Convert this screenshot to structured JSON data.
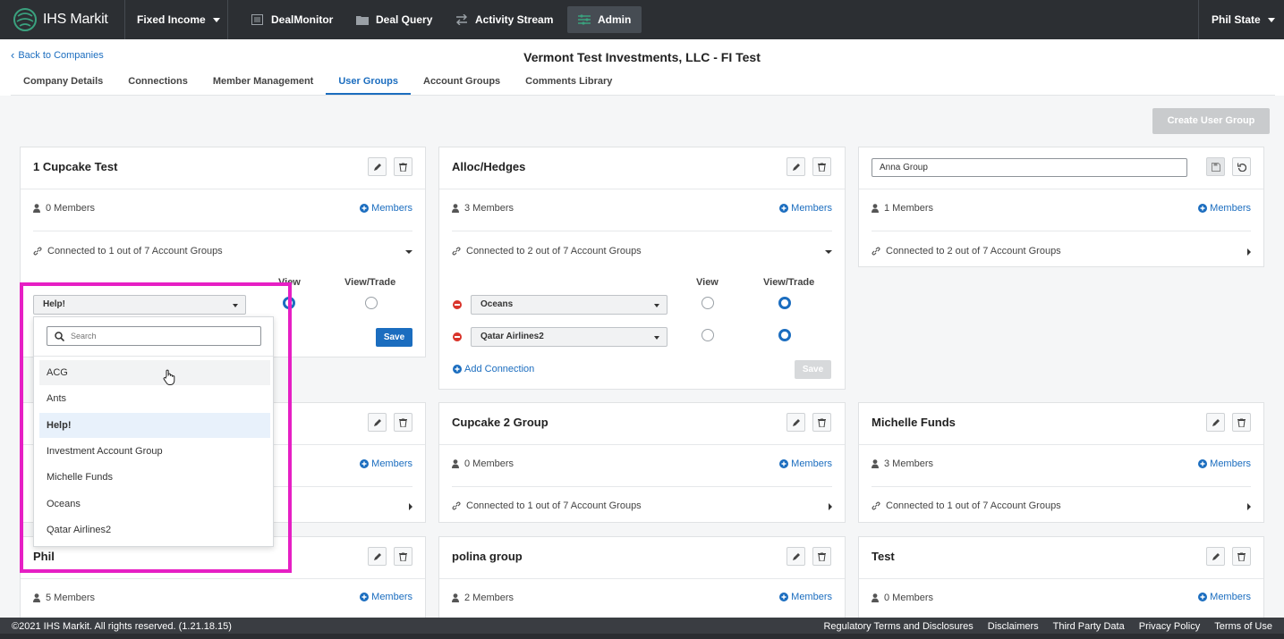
{
  "topnav": {
    "brand": "IHS Markit",
    "product": "Fixed Income",
    "items": [
      "DealMonitor",
      "Deal Query",
      "Activity Stream",
      "Admin"
    ],
    "active": "Admin",
    "user": "Phil State"
  },
  "header": {
    "back": "Back to Companies",
    "title": "Vermont Test Investments, LLC - FI Test"
  },
  "tabs": [
    "Company Details",
    "Connections",
    "Member Management",
    "User Groups",
    "Account Groups",
    "Comments Library"
  ],
  "active_tab": "User Groups",
  "create_button": "Create User Group",
  "labels": {
    "members_link": "Members",
    "view": "View",
    "view_trade": "View/Trade",
    "save": "Save",
    "add_connection": "Add Connection"
  },
  "cards": {
    "c1": {
      "title": "1 Cupcake Test",
      "members": "0 Members",
      "connected": "Connected to 1 out of 7 Account Groups",
      "select": "Help!"
    },
    "c2": {
      "title": "Alloc/Hedges",
      "members": "3 Members",
      "connected": "Connected to 2 out of 7 Account Groups",
      "conn1": "Oceans",
      "conn2": "Qatar Airlines2"
    },
    "c3": {
      "name_input": "Anna Group",
      "members": "1 Members",
      "connected": "Connected to 2 out of 7 Account Groups"
    },
    "c4": {
      "members_link": "Members"
    },
    "c5": {
      "title": "Cupcake 2 Group",
      "members": "0 Members",
      "connected": "Connected to 1 out of 7 Account Groups"
    },
    "c6": {
      "title": "Michelle Funds",
      "members": "3 Members",
      "connected": "Connected to 1 out of 7 Account Groups"
    },
    "c7": {
      "title": "Phil",
      "members": "5 Members"
    },
    "c8": {
      "title": "polina group",
      "members": "2 Members"
    },
    "c9": {
      "title": "Test",
      "members": "0 Members"
    }
  },
  "dropdown": {
    "placeholder": "Search",
    "options": [
      "ACG",
      "Ants",
      "Help!",
      "Investment Account Group",
      "Michelle Funds",
      "Oceans",
      "Qatar Airlines2"
    ],
    "selected": "Help!",
    "hovered": "ACG"
  },
  "footer": {
    "copyright": "©2021 IHS Markit. All rights reserved. (1.21.18.15)",
    "links": [
      "Regulatory Terms and Disclosures",
      "Disclaimers",
      "Third Party Data",
      "Privacy Policy",
      "Terms of Use"
    ]
  },
  "colors": {
    "accent": "#1b6dbf",
    "nav": "#2c2f33",
    "highlight": "#e61fc4",
    "danger": "#d9342b"
  },
  "icons": [
    "globe-logo-icon",
    "list-icon",
    "folder-icon",
    "swap-icon",
    "admin-icon",
    "user-icon",
    "plus-circle-icon",
    "link-icon",
    "pencil-icon",
    "trash-icon",
    "save-icon",
    "undo-icon",
    "search-icon",
    "hand-cursor-icon"
  ]
}
